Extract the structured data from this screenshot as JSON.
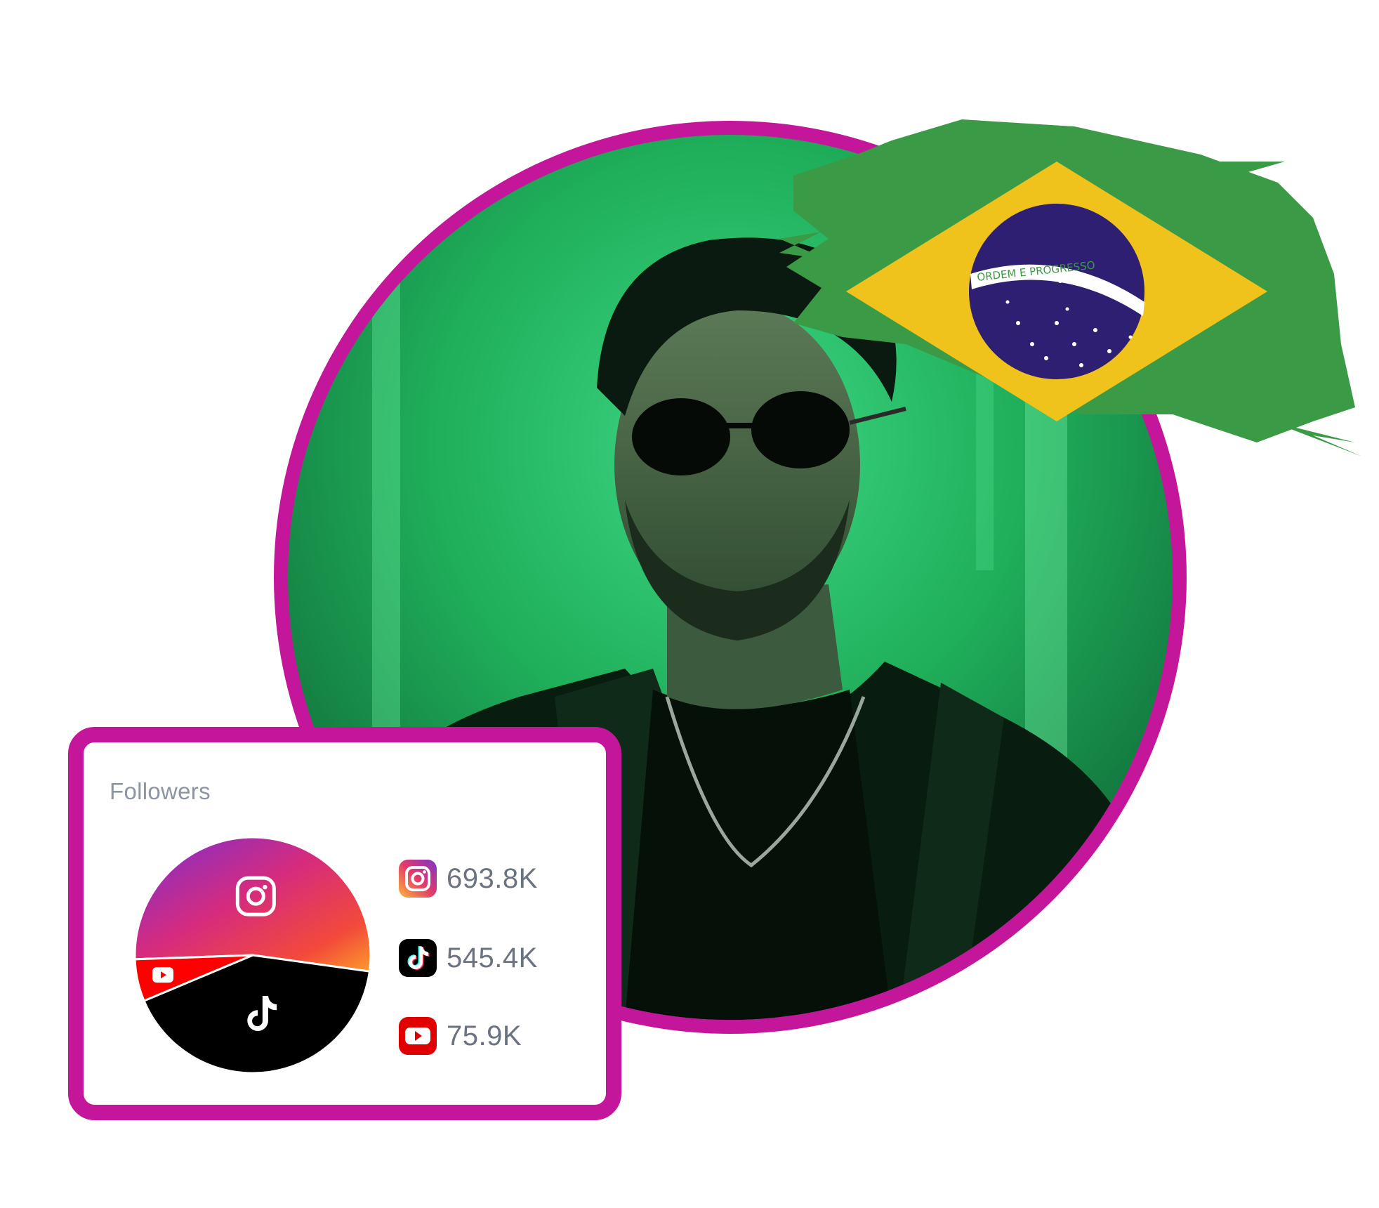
{
  "profile": {
    "photo": {
      "icon": "profile-photo",
      "ring_color": "#c4169b",
      "background_color": "#1fae5a"
    },
    "country_flag": {
      "icon": "brazil-flag",
      "motto": "ORDEM E PROGRESSO",
      "colors": {
        "green": "#3b9a45",
        "yellow": "#f0c21c",
        "blue": "#2f1f73",
        "band": "#ffffff"
      }
    }
  },
  "followers_card": {
    "title": "Followers",
    "border_color": "#c4169b",
    "stats": [
      {
        "platform": "Instagram",
        "icon": "instagram-icon",
        "value": "693.8K"
      },
      {
        "platform": "TikTok",
        "icon": "tiktok-icon",
        "value": "545.4K"
      },
      {
        "platform": "YouTube",
        "icon": "youtube-icon",
        "value": "75.9K"
      }
    ]
  },
  "chart_data": {
    "type": "pie",
    "title": "Followers",
    "categories": [
      "Instagram",
      "TikTok",
      "YouTube"
    ],
    "values": [
      693.8,
      545.4,
      75.9
    ],
    "unit": "K",
    "colors": [
      "#e1306c",
      "#000000",
      "#ff0000"
    ]
  }
}
